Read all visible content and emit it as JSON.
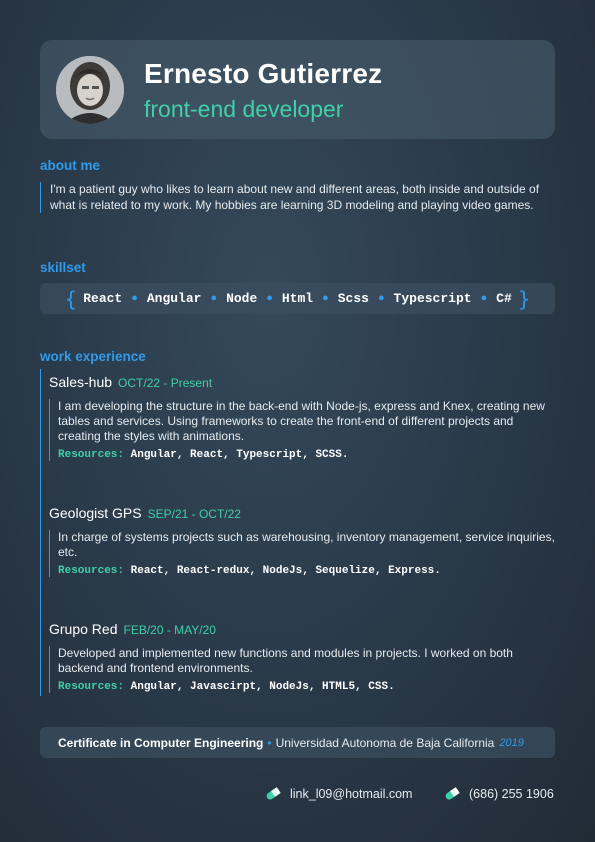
{
  "header": {
    "name": "Ernesto Gutierrez",
    "role": "front-end developer"
  },
  "about": {
    "title": "about me",
    "text": "I'm a patient guy who likes to learn about new and different areas, both inside and outside of what is related to my work. My hobbies are learning 3D modeling and playing video games."
  },
  "skillset": {
    "title": "skillset",
    "open_brace": "{",
    "close_brace": "}",
    "items": [
      "React",
      "Angular",
      "Node",
      "Html",
      "Scss",
      "Typescript",
      "C#"
    ]
  },
  "work": {
    "title": "work experience",
    "resources_label": "Resources:",
    "jobs": [
      {
        "company": "Sales-hub",
        "dates": "OCT/22 - Present",
        "description": "I am developing the structure in the back-end with Node-js, express and Knex, creating new tables and services. Using frameworks to create the front-end of different projects and creating the styles with animations.",
        "resources": "Angular, React, Typescript, SCSS."
      },
      {
        "company": "Geologist GPS",
        "dates": "SEP/21 - OCT/22",
        "description": "In charge of systems projects such as warehousing, inventory management, service inquiries, etc.",
        "resources": "React, React-redux, NodeJs, Sequelize, Express."
      },
      {
        "company": "Grupo Red",
        "dates": "FEB/20 - MAY/20",
        "description": "Developed and implemented new functions and modules in projects. I worked on both backend and frontend environments.",
        "resources": "Angular, Javascirpt, NodeJs, HTML5, CSS."
      }
    ]
  },
  "certificate": {
    "title": "Certificate in Computer Engineering",
    "separator": "•",
    "institution": "Universidad Autonoma de Baja California",
    "year": "2019"
  },
  "contact": {
    "email": "link_l09@hotmail.com",
    "phone": "(686) 255 1906",
    "icon": "pill-icon"
  },
  "colors": {
    "accent_blue": "#2f9bea",
    "accent_teal": "#3fd0a8",
    "background": "#2b3b4b"
  }
}
